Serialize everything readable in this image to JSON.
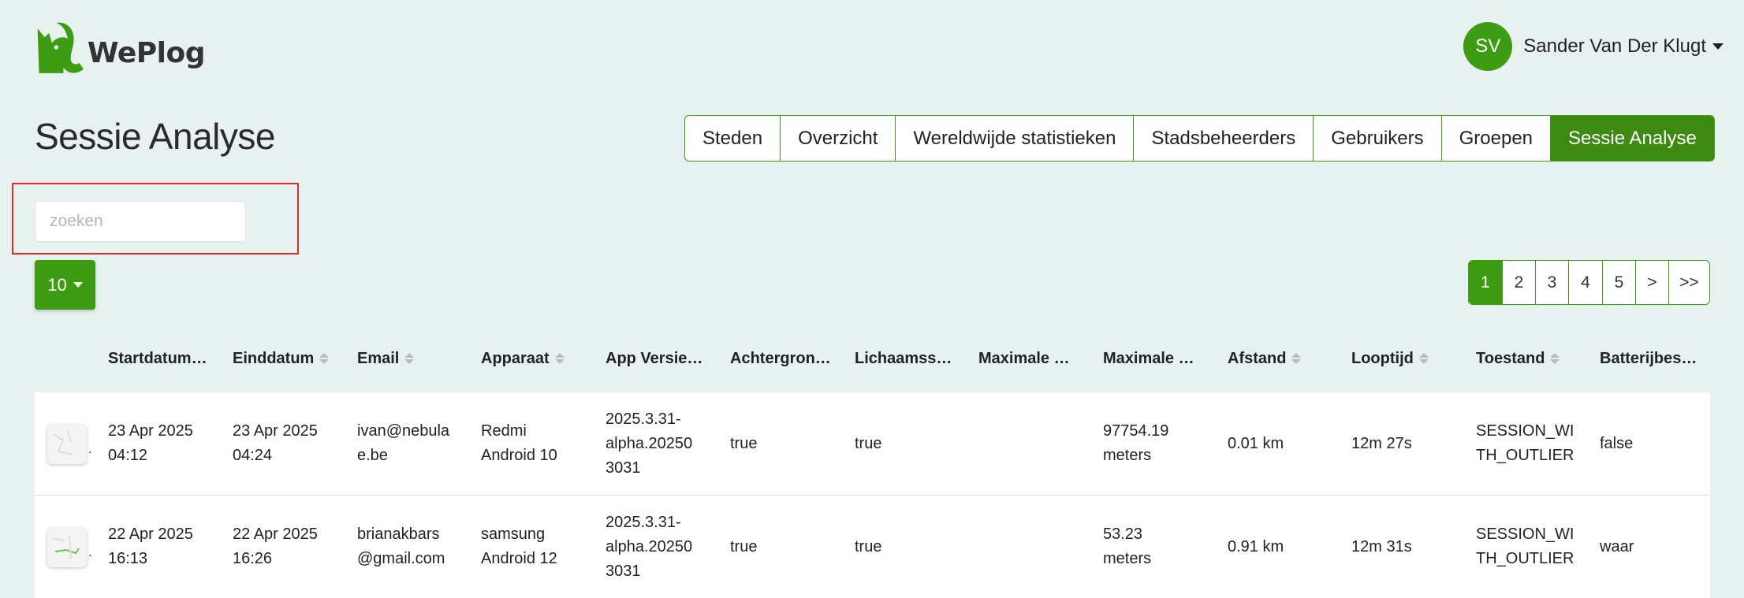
{
  "app": {
    "logo_text": "WePlog",
    "user_initials": "SV",
    "user_name": "Sander Van Der Klugt",
    "accent_color": "#3d9c12"
  },
  "page": {
    "title": "Sessie Analyse"
  },
  "tabs": [
    {
      "label": "Steden",
      "active": false
    },
    {
      "label": "Overzicht",
      "active": false
    },
    {
      "label": "Wereldwijde statistieken",
      "active": false
    },
    {
      "label": "Stadsbeheerders",
      "active": false
    },
    {
      "label": "Gebruikers",
      "active": false
    },
    {
      "label": "Groepen",
      "active": false
    },
    {
      "label": "Sessie Analyse",
      "active": true
    }
  ],
  "search": {
    "placeholder": "zoeken",
    "value": ""
  },
  "page_size": {
    "value": "10"
  },
  "pagination": {
    "pages": [
      "1",
      "2",
      "3",
      "4",
      "5",
      ">",
      ">>"
    ],
    "current": "1"
  },
  "table": {
    "columns": [
      {
        "label": "Startdatum…",
        "sortable": false
      },
      {
        "label": "Einddatum",
        "sortable": true
      },
      {
        "label": "Email",
        "sortable": true
      },
      {
        "label": "Apparaat",
        "sortable": true
      },
      {
        "label": "App Versie…",
        "sortable": false
      },
      {
        "label": "Achtergron…",
        "sortable": false
      },
      {
        "label": "Lichaamss…",
        "sortable": false
      },
      {
        "label": "Maximale …",
        "sortable": false
      },
      {
        "label": "Maximale …",
        "sortable": false
      },
      {
        "label": "Afstand",
        "sortable": true
      },
      {
        "label": "Looptijd",
        "sortable": true
      },
      {
        "label": "Toestand",
        "sortable": true
      },
      {
        "label": "Batterijbes…",
        "sortable": false
      }
    ],
    "rows": [
      {
        "cells": [
          [
            "23 Apr 2025",
            "04:12"
          ],
          [
            "23 Apr 2025",
            "04:24"
          ],
          [
            "ivan@nebula",
            "e.be"
          ],
          [
            "Redmi",
            "Android 10"
          ],
          [
            "2025.3.31-",
            "alpha.20250",
            "3031"
          ],
          [
            "true"
          ],
          [
            "true"
          ],
          [
            ""
          ],
          [
            "97754.19",
            "meters"
          ],
          [
            "0.01 km"
          ],
          [
            "12m 27s"
          ],
          [
            "SESSION_WI",
            "TH_OUTLIER"
          ],
          [
            "false"
          ]
        ]
      },
      {
        "cells": [
          [
            "22 Apr 2025",
            "16:13"
          ],
          [
            "22 Apr 2025",
            "16:26"
          ],
          [
            "brianakbars",
            "@gmail.com"
          ],
          [
            "samsung",
            "Android 12"
          ],
          [
            "2025.3.31-",
            "alpha.20250",
            "3031"
          ],
          [
            "true"
          ],
          [
            "true"
          ],
          [
            ""
          ],
          [
            "53.23",
            "meters"
          ],
          [
            "0.91 km"
          ],
          [
            "12m 31s"
          ],
          [
            "SESSION_WI",
            "TH_OUTLIER"
          ],
          [
            "waar"
          ]
        ]
      }
    ]
  }
}
